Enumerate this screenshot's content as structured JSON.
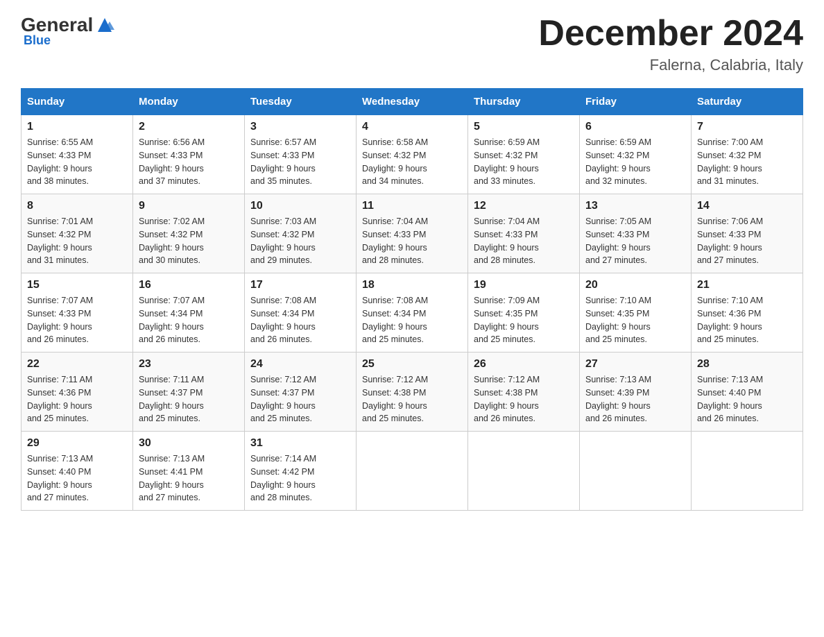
{
  "header": {
    "logo_general": "General",
    "logo_blue": "Blue",
    "month_title": "December 2024",
    "location": "Falerna, Calabria, Italy"
  },
  "weekdays": [
    "Sunday",
    "Monday",
    "Tuesday",
    "Wednesday",
    "Thursday",
    "Friday",
    "Saturday"
  ],
  "weeks": [
    [
      {
        "day": "1",
        "sunrise": "6:55 AM",
        "sunset": "4:33 PM",
        "daylight": "9 hours and 38 minutes."
      },
      {
        "day": "2",
        "sunrise": "6:56 AM",
        "sunset": "4:33 PM",
        "daylight": "9 hours and 37 minutes."
      },
      {
        "day": "3",
        "sunrise": "6:57 AM",
        "sunset": "4:33 PM",
        "daylight": "9 hours and 35 minutes."
      },
      {
        "day": "4",
        "sunrise": "6:58 AM",
        "sunset": "4:32 PM",
        "daylight": "9 hours and 34 minutes."
      },
      {
        "day": "5",
        "sunrise": "6:59 AM",
        "sunset": "4:32 PM",
        "daylight": "9 hours and 33 minutes."
      },
      {
        "day": "6",
        "sunrise": "6:59 AM",
        "sunset": "4:32 PM",
        "daylight": "9 hours and 32 minutes."
      },
      {
        "day": "7",
        "sunrise": "7:00 AM",
        "sunset": "4:32 PM",
        "daylight": "9 hours and 31 minutes."
      }
    ],
    [
      {
        "day": "8",
        "sunrise": "7:01 AM",
        "sunset": "4:32 PM",
        "daylight": "9 hours and 31 minutes."
      },
      {
        "day": "9",
        "sunrise": "7:02 AM",
        "sunset": "4:32 PM",
        "daylight": "9 hours and 30 minutes."
      },
      {
        "day": "10",
        "sunrise": "7:03 AM",
        "sunset": "4:32 PM",
        "daylight": "9 hours and 29 minutes."
      },
      {
        "day": "11",
        "sunrise": "7:04 AM",
        "sunset": "4:33 PM",
        "daylight": "9 hours and 28 minutes."
      },
      {
        "day": "12",
        "sunrise": "7:04 AM",
        "sunset": "4:33 PM",
        "daylight": "9 hours and 28 minutes."
      },
      {
        "day": "13",
        "sunrise": "7:05 AM",
        "sunset": "4:33 PM",
        "daylight": "9 hours and 27 minutes."
      },
      {
        "day": "14",
        "sunrise": "7:06 AM",
        "sunset": "4:33 PM",
        "daylight": "9 hours and 27 minutes."
      }
    ],
    [
      {
        "day": "15",
        "sunrise": "7:07 AM",
        "sunset": "4:33 PM",
        "daylight": "9 hours and 26 minutes."
      },
      {
        "day": "16",
        "sunrise": "7:07 AM",
        "sunset": "4:34 PM",
        "daylight": "9 hours and 26 minutes."
      },
      {
        "day": "17",
        "sunrise": "7:08 AM",
        "sunset": "4:34 PM",
        "daylight": "9 hours and 26 minutes."
      },
      {
        "day": "18",
        "sunrise": "7:08 AM",
        "sunset": "4:34 PM",
        "daylight": "9 hours and 25 minutes."
      },
      {
        "day": "19",
        "sunrise": "7:09 AM",
        "sunset": "4:35 PM",
        "daylight": "9 hours and 25 minutes."
      },
      {
        "day": "20",
        "sunrise": "7:10 AM",
        "sunset": "4:35 PM",
        "daylight": "9 hours and 25 minutes."
      },
      {
        "day": "21",
        "sunrise": "7:10 AM",
        "sunset": "4:36 PM",
        "daylight": "9 hours and 25 minutes."
      }
    ],
    [
      {
        "day": "22",
        "sunrise": "7:11 AM",
        "sunset": "4:36 PM",
        "daylight": "9 hours and 25 minutes."
      },
      {
        "day": "23",
        "sunrise": "7:11 AM",
        "sunset": "4:37 PM",
        "daylight": "9 hours and 25 minutes."
      },
      {
        "day": "24",
        "sunrise": "7:12 AM",
        "sunset": "4:37 PM",
        "daylight": "9 hours and 25 minutes."
      },
      {
        "day": "25",
        "sunrise": "7:12 AM",
        "sunset": "4:38 PM",
        "daylight": "9 hours and 25 minutes."
      },
      {
        "day": "26",
        "sunrise": "7:12 AM",
        "sunset": "4:38 PM",
        "daylight": "9 hours and 26 minutes."
      },
      {
        "day": "27",
        "sunrise": "7:13 AM",
        "sunset": "4:39 PM",
        "daylight": "9 hours and 26 minutes."
      },
      {
        "day": "28",
        "sunrise": "7:13 AM",
        "sunset": "4:40 PM",
        "daylight": "9 hours and 26 minutes."
      }
    ],
    [
      {
        "day": "29",
        "sunrise": "7:13 AM",
        "sunset": "4:40 PM",
        "daylight": "9 hours and 27 minutes."
      },
      {
        "day": "30",
        "sunrise": "7:13 AM",
        "sunset": "4:41 PM",
        "daylight": "9 hours and 27 minutes."
      },
      {
        "day": "31",
        "sunrise": "7:14 AM",
        "sunset": "4:42 PM",
        "daylight": "9 hours and 28 minutes."
      },
      null,
      null,
      null,
      null
    ]
  ],
  "labels": {
    "sunrise": "Sunrise:",
    "sunset": "Sunset:",
    "daylight": "Daylight:"
  }
}
